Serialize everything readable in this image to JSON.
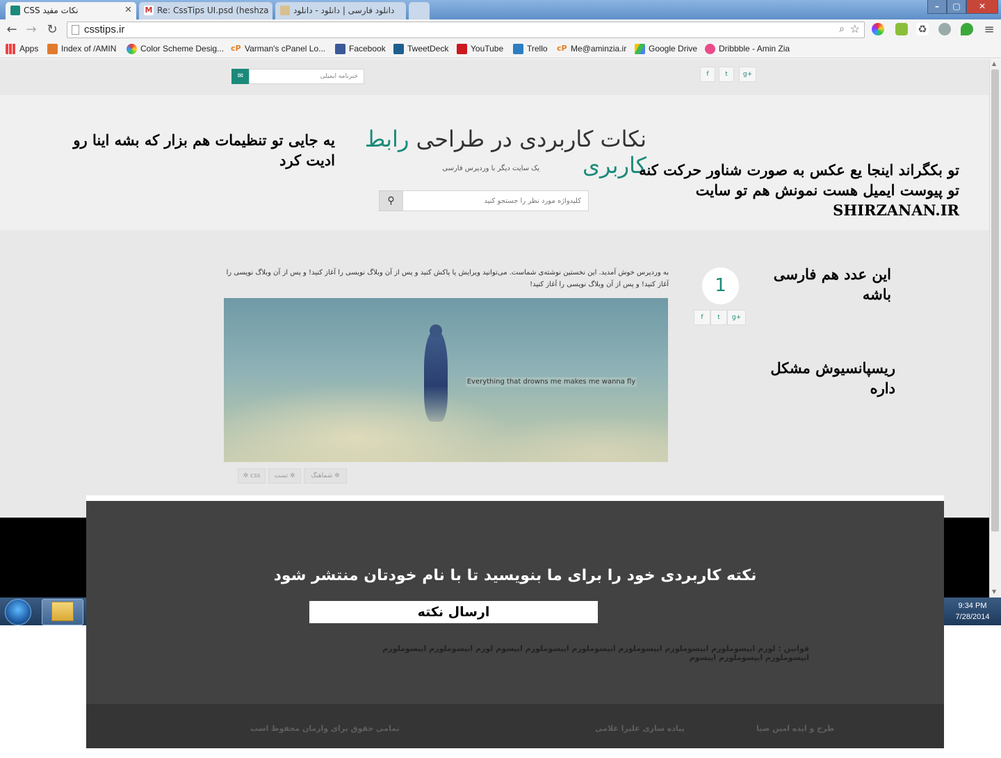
{
  "browser": {
    "tabs": [
      {
        "title": "نکات مفید CSS",
        "active": true
      },
      {
        "title": "Re: CssTips UI.psd (heshza",
        "active": false
      },
      {
        "title": "دانلود فارسی | دانلود - دانلود",
        "active": false
      }
    ],
    "address": "csstips.ir",
    "bookmarks": [
      "Apps",
      "Index of /AMIN",
      "Color Scheme Desig...",
      "Varman's cPanel Lo...",
      "Facebook",
      "TweetDeck",
      "YouTube",
      "Trello",
      "Me@aminzia.ir",
      "Google Drive",
      "Dribbble - Amin Zia"
    ],
    "colors": {
      "tabstrip": "#5f8fc8",
      "accent": "#1b8a7a"
    }
  },
  "topbar": {
    "newsletter_placeholder": "خبرنامه ایمیلی",
    "newsletter_icon": "mail-icon",
    "social": [
      "f",
      "t",
      "g+"
    ]
  },
  "header": {
    "title_main": "نکات کاربردی در طراحی ",
    "title_accent": "رابط کاربری",
    "tagline": "یک سایت دیگر با وردپرس فارسی",
    "search_placeholder": "کلیدواژه مورد نظر را جستجو کنید",
    "search_icon": "search-icon"
  },
  "notes": {
    "left": "یه جایی تو تنظیمات هم بزار که بشه اینا رو ادیت کرد",
    "right_line1": "تو بکگراند اینجا یع عکس به صورت شناور حرکت کنه",
    "right_line2": "تو پیوست ایمیل هست نمونش هم تو سایت SHIRZANAN.IR",
    "number": "این عدد هم فارسی باشه",
    "responsive": "ریسپانسیوش مشکل داره"
  },
  "post": {
    "number": "1",
    "excerpt": "به وردپرس خوش آمدید. این نخستین نوشته‌ی شماست. می‌توانید ویرایش یا پاکش کنید و پس از آن وبلاگ نویسی را آغاز کنید! و پس از آن وبلاگ نویسی را آغاز کنید! و پس از آن وبلاگ نویسی را آغاز کنید!",
    "image_caption": "Everything that drowns me makes me wanna fly",
    "tags": [
      "شماهنگ",
      "تست",
      "css"
    ],
    "social": [
      "f",
      "t",
      "g+"
    ]
  },
  "submit": {
    "title": "نکته کاربردی خود را برای ما بنویسید تا با نام خودتان منتشر شود",
    "button": "ارسال نکته",
    "rules": "قوانین : لورم ایپسوملورم ایپسوملورم ایپسوملورم ایپسوملورم ایپسوملورم ایپسوم لورم ایپسوملورم ایپسوملورم ایپسوملورم ایپسوملورم ایپسوم"
  },
  "footer": {
    "design": "طرح و ایده امین ضیا",
    "implementation": "پیاده سازی علیرا غلامی",
    "copyright": "تمامی حقوق برای وارمان محفوظ است"
  },
  "taskbar": {
    "time": "9:34 PM",
    "date": "7/28/2014"
  }
}
